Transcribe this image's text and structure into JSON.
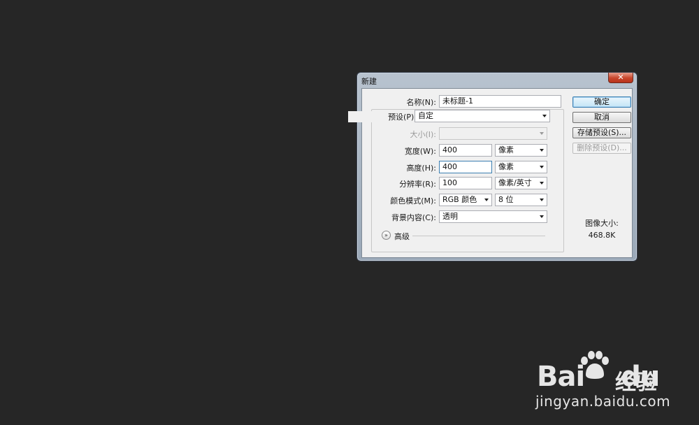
{
  "window": {
    "title": "新建",
    "close_glyph": "✕"
  },
  "form": {
    "name_label": "名称(N):",
    "name_value": "未标题-1",
    "preset_label": "预设(P):",
    "preset_value": "自定",
    "size_label": "大小(I):",
    "size_value": "",
    "width_label": "宽度(W):",
    "width_value": "400",
    "width_unit": "像素",
    "height_label": "高度(H):",
    "height_value": "400",
    "height_unit": "像素",
    "resolution_label": "分辨率(R):",
    "resolution_value": "100",
    "resolution_unit": "像素/英寸",
    "color_mode_label": "颜色模式(M):",
    "color_mode_value": "RGB 颜色",
    "bit_depth_value": "8 位",
    "background_label": "背景内容(C):",
    "background_value": "透明",
    "advanced_label": "高级",
    "advanced_icon": "double-chevron-down-icon"
  },
  "buttons": {
    "ok": "确定",
    "cancel": "取消",
    "save_preset": "存储预设(S)...",
    "delete_preset": "删除预设(D)..."
  },
  "info": {
    "image_size_label": "图像大小:",
    "image_size_value": "468.8K"
  },
  "watermark": {
    "logo": "Bai",
    "logo_tail": "du",
    "brand": "经验",
    "url": "jingyan.baidu.com"
  },
  "colors": {
    "background": "#262626",
    "dialog_face": "#f0f0f0",
    "focus_border": "#3c7fb1"
  }
}
